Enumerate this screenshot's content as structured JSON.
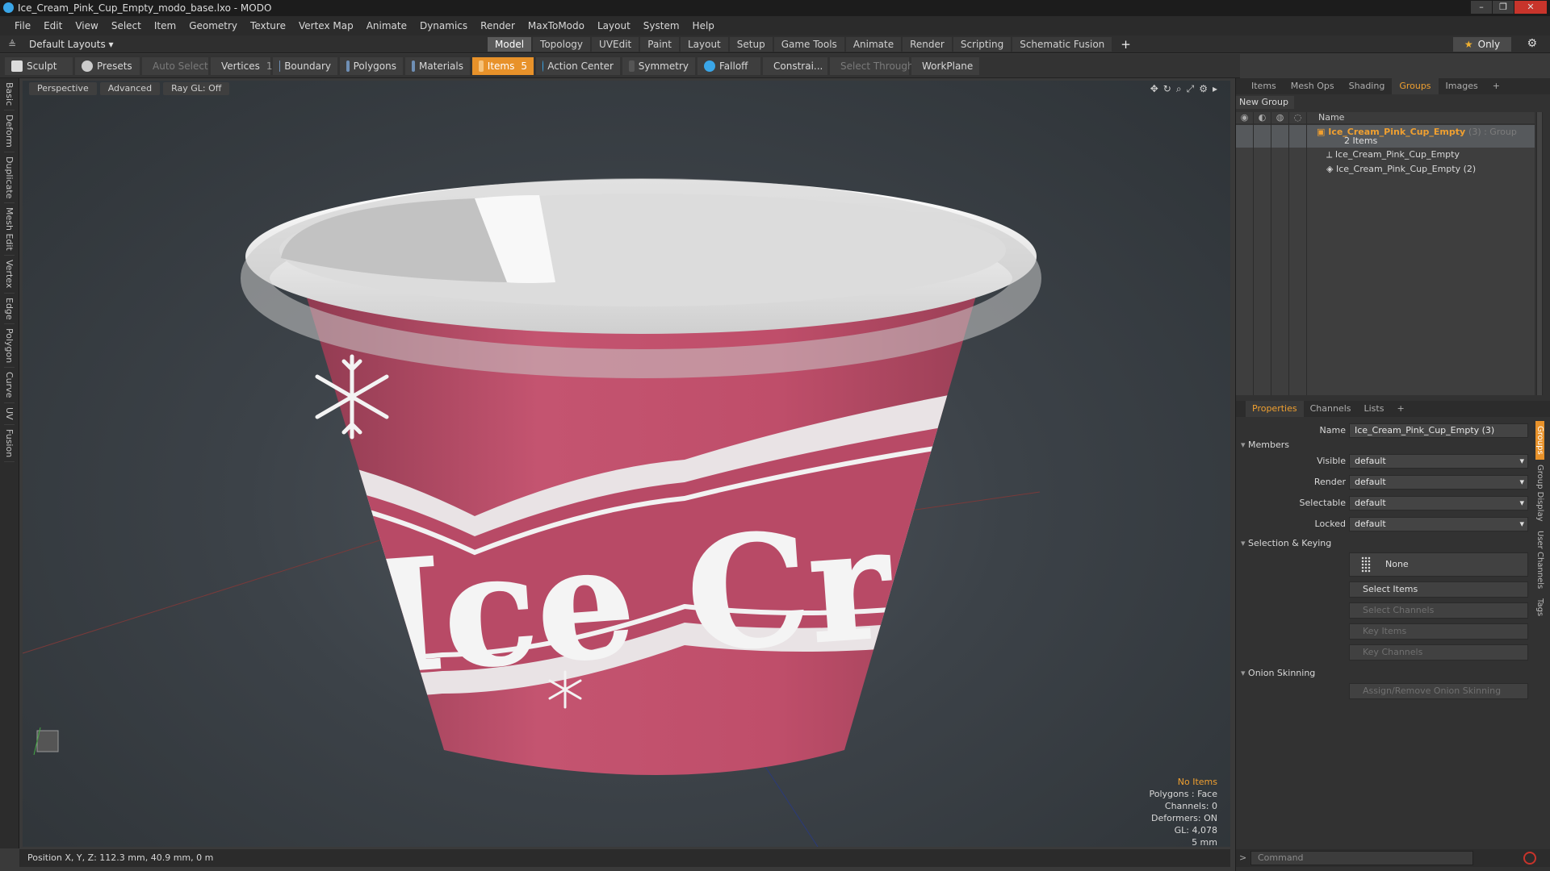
{
  "window": {
    "title": "Ice_Cream_Pink_Cup_Empty_modo_base.lxo - MODO",
    "controls": [
      "–",
      "❐",
      "✕"
    ]
  },
  "menu": [
    "File",
    "Edit",
    "View",
    "Select",
    "Item",
    "Geometry",
    "Texture",
    "Vertex Map",
    "Animate",
    "Dynamics",
    "Render",
    "MaxToModo",
    "Layout",
    "System",
    "Help"
  ],
  "layout_selector": "Default Layouts ▾",
  "mode_tabs": [
    {
      "label": "Model",
      "active": true
    },
    {
      "label": "Topology"
    },
    {
      "label": "UVEdit"
    },
    {
      "label": "Paint"
    },
    {
      "label": "Layout"
    },
    {
      "label": "Setup"
    },
    {
      "label": "Game Tools"
    },
    {
      "label": "Animate"
    },
    {
      "label": "Render"
    },
    {
      "label": "Scripting"
    },
    {
      "label": "Schematic Fusion"
    }
  ],
  "only_label": "Only",
  "toolbar": {
    "sculpt": "Sculpt",
    "presets": "Presets",
    "auto_select": "Auto Select",
    "vertices": "Vertices",
    "vertices_count": "1",
    "boundary": "Boundary",
    "polygons": "Polygons",
    "materials": "Materials",
    "items": "Items",
    "items_count": "5",
    "action_center": "Action Center",
    "symmetry": "Symmetry",
    "falloff": "Falloff",
    "constraints": "Constrai...",
    "select_through": "Select Through",
    "workplane": "WorkPlane"
  },
  "left_tabs": [
    "Basic",
    "Deform",
    "Duplicate",
    "Mesh Edit",
    "Vertex",
    "Edge",
    "Polygon",
    "Curve",
    "UV",
    "Fusion"
  ],
  "viewport": {
    "view_mode": "Perspective",
    "shading": "Advanced",
    "raygl": "Ray GL: Off",
    "info": {
      "selection": "No Items",
      "polygons": "Polygons : Face",
      "channels": "Channels: 0",
      "deformers": "Deformers: ON",
      "gl": "GL: 4,078",
      "unit": "5 mm"
    }
  },
  "status": "Position X, Y, Z:  112.3 mm, 40.9 mm, 0 m",
  "panel_tabs": [
    {
      "label": "Items"
    },
    {
      "label": "Mesh Ops"
    },
    {
      "label": "Shading"
    },
    {
      "label": "Groups",
      "active": true
    },
    {
      "label": "Images"
    }
  ],
  "new_group": "New Group",
  "groups_header": "Name",
  "groups": {
    "root": "Ice_Cream_Pink_Cup_Empty",
    "root_suffix": "(3) : Group",
    "count": "2 Items",
    "child1": "Ice_Cream_Pink_Cup_Empty",
    "child2": "Ice_Cream_Pink_Cup_Empty (2)"
  },
  "props_tabs": [
    {
      "label": "Properties",
      "active": true
    },
    {
      "label": "Channels"
    },
    {
      "label": "Lists"
    }
  ],
  "properties": {
    "name_label": "Name",
    "name_value": "Ice_Cream_Pink_Cup_Empty (3)",
    "members": "Members",
    "visible_label": "Visible",
    "visible": "default",
    "render_label": "Render",
    "render": "default",
    "selectable_label": "Selectable",
    "selectable": "default",
    "locked_label": "Locked",
    "locked": "default",
    "sel_keying": "Selection & Keying",
    "none": "None",
    "select_items": "Select Items",
    "select_channels": "Select Channels",
    "key_items": "Key Items",
    "key_channels": "Key Channels",
    "onion": "Onion Skinning",
    "assign_onion": "Assign/Remove Onion Skinning"
  },
  "side_tabs": [
    "Groups",
    "Group Display",
    "User Channels",
    "Tags"
  ],
  "command_placeholder": "Command",
  "cup_text": "Ice Cr",
  "colors": {
    "accent": "#e8922a",
    "cup_pink": "#c04f6b",
    "rim_white": "#e8e8e8"
  }
}
